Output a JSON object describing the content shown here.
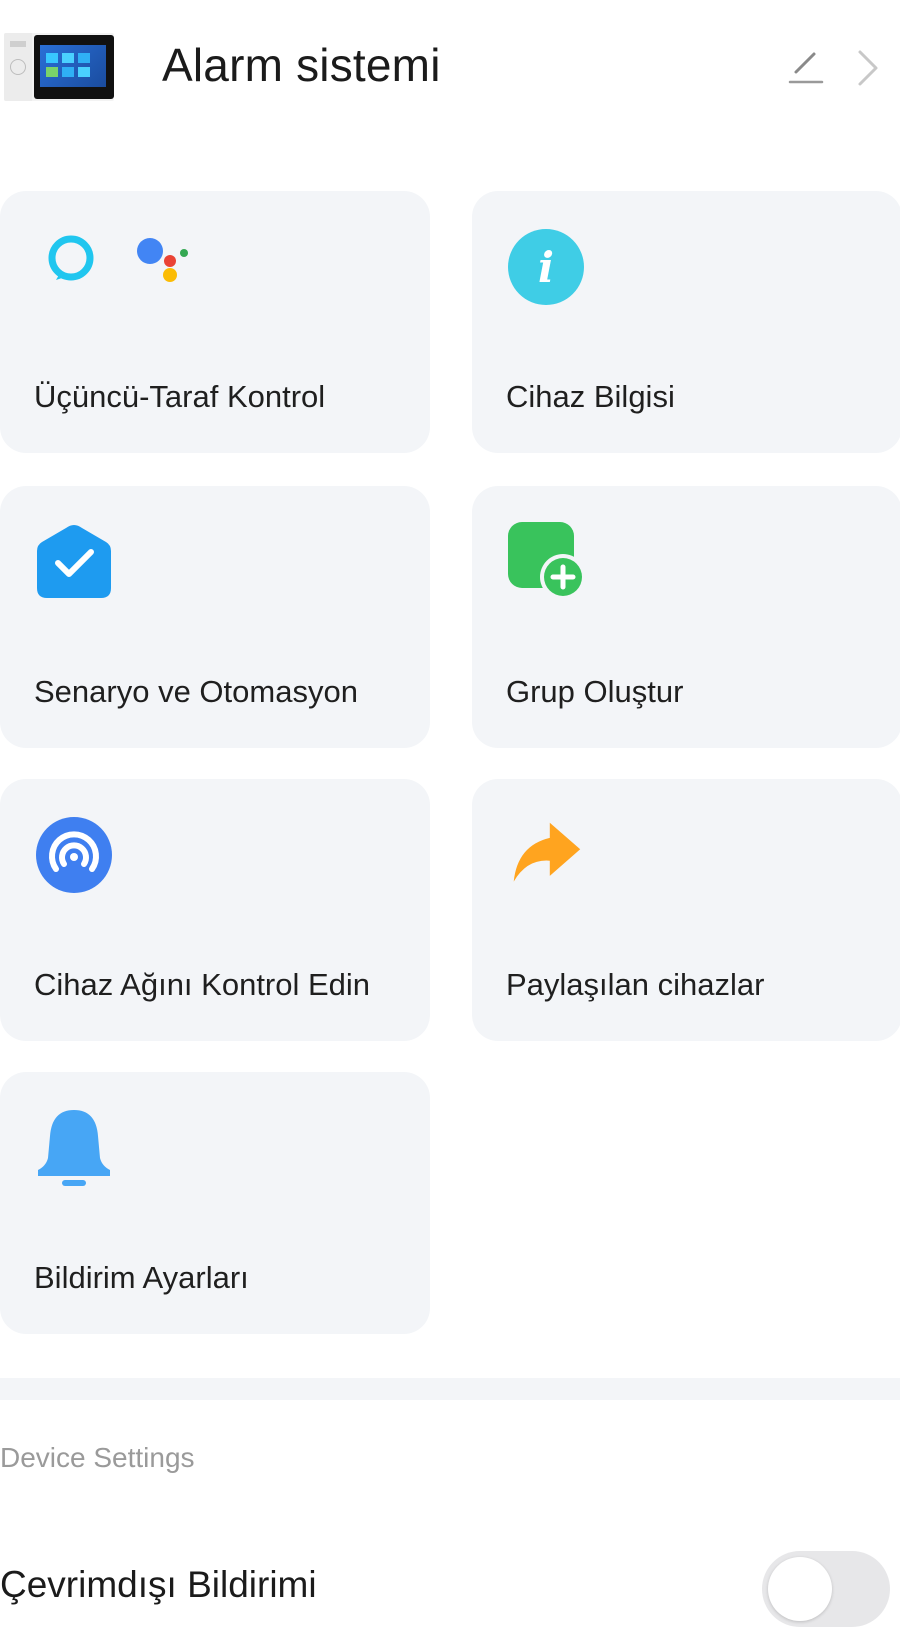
{
  "header": {
    "title": "Alarm sistemi",
    "device_image": "alarm-panel-thumbnail",
    "edit_icon": "pencil-icon",
    "more_icon": "chevron-right-icon"
  },
  "cards": [
    {
      "id": "third-party",
      "label": "Üçüncü-Taraf Kontrol",
      "icon": "alexa-google-assistant-icon"
    },
    {
      "id": "device-info",
      "label": "Cihaz Bilgisi",
      "icon": "info-icon"
    },
    {
      "id": "scenes",
      "label": "Senaryo ve Otomasyon",
      "icon": "checkmark-shield-icon"
    },
    {
      "id": "create-group",
      "label": "Grup Oluştur",
      "icon": "add-group-icon"
    },
    {
      "id": "device-network",
      "label": "Cihaz Ağını Kontrol Edin",
      "icon": "network-signal-icon"
    },
    {
      "id": "shared",
      "label": "Paylaşılan cihazlar",
      "icon": "share-arrow-icon"
    },
    {
      "id": "notifications",
      "label": "Bildirim Ayarları",
      "icon": "bell-icon"
    }
  ],
  "settings": {
    "section_title": "Device Settings",
    "offline_notification": {
      "label": "Çevrimdışı Bildirimi",
      "enabled": false
    }
  },
  "colors": {
    "card_bg": "#f3f5f8",
    "info_cyan": "#3fcde6",
    "scene_blue": "#1e9bf0",
    "group_green": "#39c35c",
    "network_blue": "#3f7ff0",
    "share_orange": "#ffa41f",
    "bell_blue": "#47a6f5"
  }
}
